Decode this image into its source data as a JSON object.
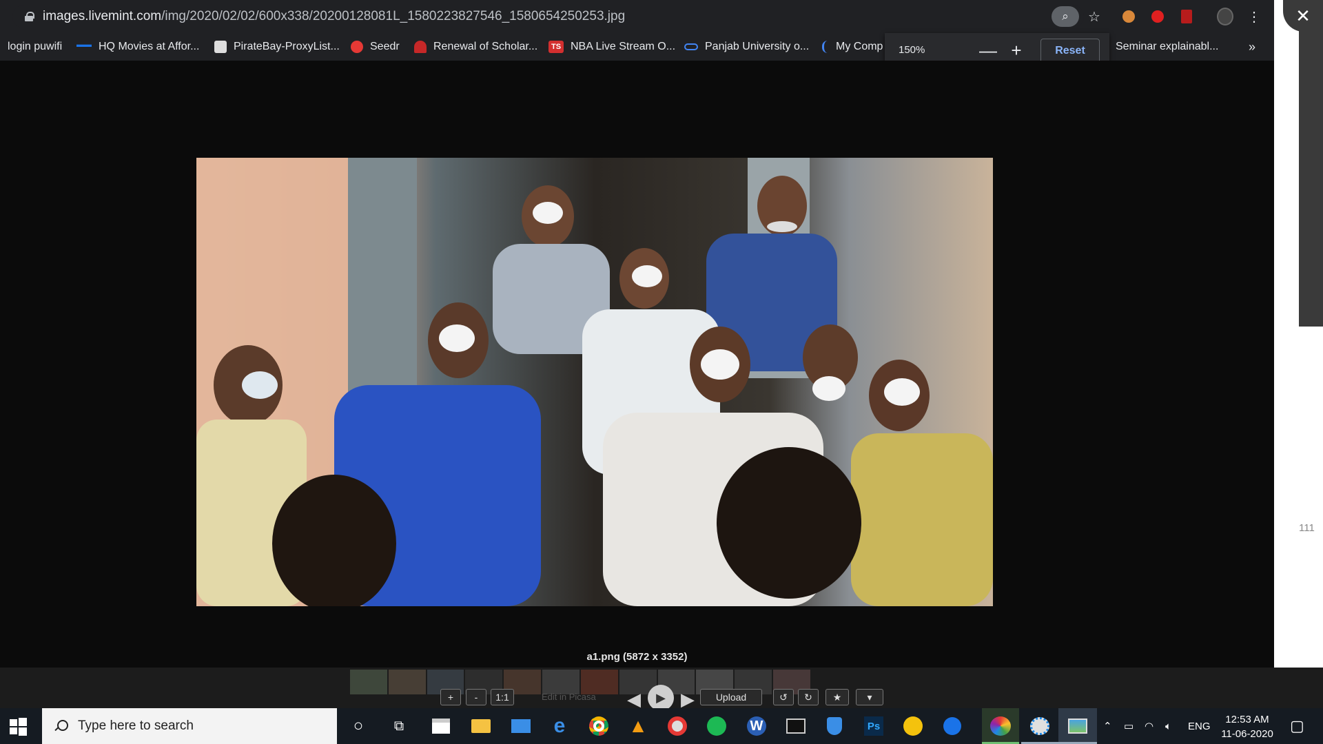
{
  "browser": {
    "url_domain": "images.livemint.com",
    "url_path": "/img/2020/02/02/600x338/20200128081L_1580223827546_1580654250253.jpg",
    "zoom_popup": {
      "level": "150%",
      "minus": "—",
      "plus": "+",
      "reset": "Reset"
    },
    "bookmarks": [
      {
        "label": "login puwifi",
        "icon": "none"
      },
      {
        "label": "HQ Movies at Affor...",
        "icon": "movie-icon",
        "color": "#1a73e8"
      },
      {
        "label": "PirateBay-ProxyList...",
        "icon": "ship-icon",
        "color": "#777777"
      },
      {
        "label": "Seedr",
        "icon": "seedr-icon",
        "color": "#e53935"
      },
      {
        "label": "Renewal of Scholar...",
        "icon": "emblem-icon",
        "color": "#c62828"
      },
      {
        "label": "NBA Live Stream O...",
        "icon": "ts-icon",
        "color": "#d32f2f",
        "icon_text": "TS"
      },
      {
        "label": "Panjab University o...",
        "icon": "link-icon",
        "color": "#4285f4"
      },
      {
        "label": "My Comp",
        "icon": "bracket-icon",
        "color": "#4285f4"
      },
      {
        "label": "Seminar explainabl...",
        "icon": "none"
      }
    ],
    "more_bookmarks": "»"
  },
  "viewer": {
    "caption": "a1.png (5872 x 3352)",
    "controls": {
      "zoom_in": "+",
      "zoom_out": "-",
      "actual_size": "1:1",
      "edit": "Edit in Picasa",
      "upload": "Upload",
      "rotate_left": "↺",
      "rotate_right": "↻",
      "star": "★",
      "more": "▾"
    },
    "side_text": "111"
  },
  "taskbar": {
    "search_placeholder": "Type here to search",
    "language": "ENG",
    "time": "12:53 AM",
    "date": "11-06-2020",
    "apps": [
      "cortana-icon",
      "task-view-icon",
      "store-icon",
      "file-explorer-icon",
      "mail-icon",
      "edge-icon",
      "chrome-icon",
      "vlc-icon",
      "groove-icon",
      "spotify-icon",
      "word-icon",
      "terminal-icon",
      "defender-icon",
      "photoshop-icon",
      "emoji-icon",
      "maps-icon",
      "picasa-icon",
      "paint-icon",
      "photos-viewer-icon"
    ]
  }
}
